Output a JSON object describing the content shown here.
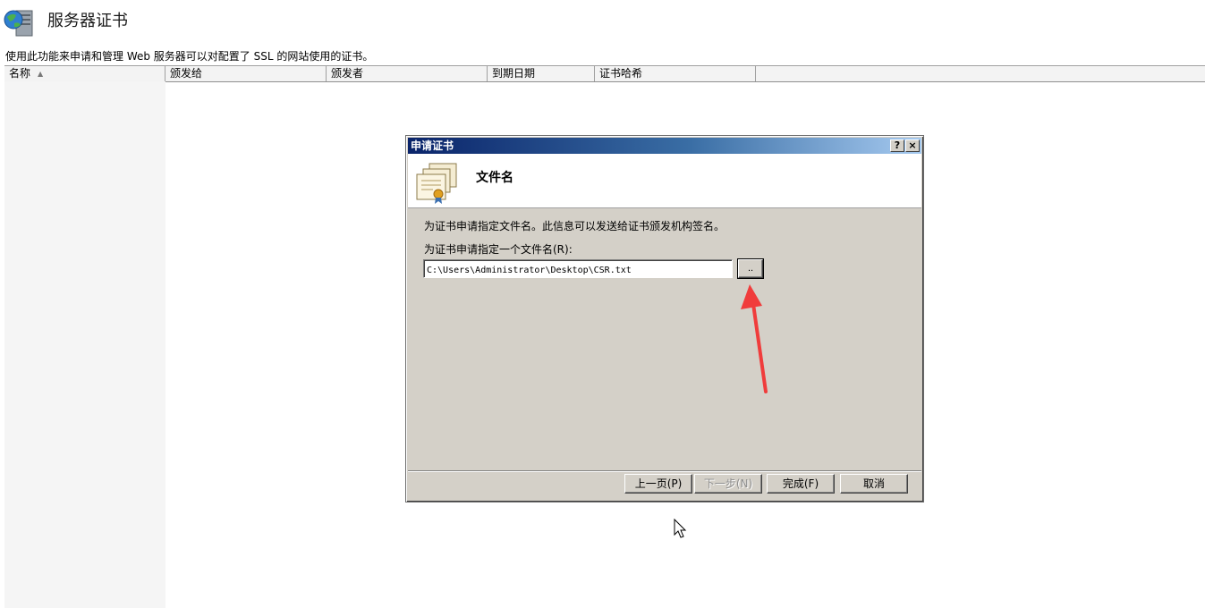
{
  "header": {
    "title": "服务器证书",
    "description": "使用此功能来申请和管理 Web 服务器可以对配置了 SSL 的网站使用的证书。",
    "icon": "server-globe-icon"
  },
  "columns": [
    "名称",
    "颁发给",
    "颁发者",
    "到期日期",
    "证书哈希"
  ],
  "dialog": {
    "title": "申请证书",
    "help_button": "?",
    "close_button": "×",
    "heading": "文件名",
    "description": "为证书申请指定文件名。此信息可以发送给证书颁发机构签名。",
    "field_label": "为证书申请指定一个文件名(R):",
    "file_path": "C:\\Users\\Administrator\\Desktop\\CSR.txt",
    "browse_label": "..",
    "buttons": {
      "prev": "上一页(P)",
      "next": "下一步(N)",
      "finish": "完成(F)",
      "cancel": "取消"
    }
  },
  "colors": {
    "titlebar_start": "#0a246a",
    "titlebar_end": "#a6caf0",
    "dialog_bg": "#d4d0c8",
    "annotation_arrow": "#f03c3c"
  }
}
